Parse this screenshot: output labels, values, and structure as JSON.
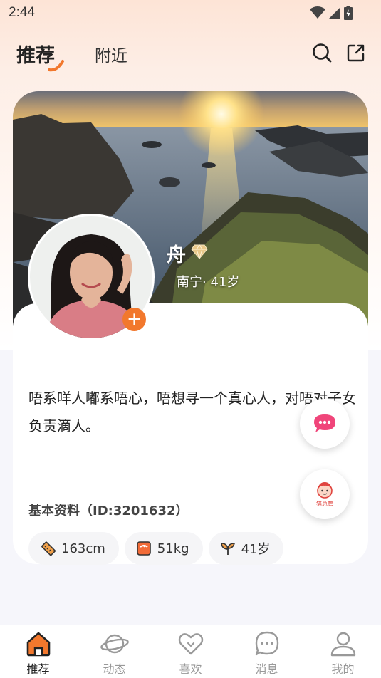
{
  "status": {
    "time": "2:44"
  },
  "header": {
    "tab_active": "推荐",
    "tab_other": "附近"
  },
  "profile": {
    "name": "舟",
    "location_age": "南宁· 41岁",
    "intro": "唔系咩人嘟系唔心，唔想寻一个真心人，对唔对子女负责滴人。",
    "basic_info_title": "基本资料（ID:3201632）",
    "chips": [
      {
        "icon": "ruler-icon",
        "label": "163cm"
      },
      {
        "icon": "scale-icon",
        "label": "51kg"
      },
      {
        "icon": "sprout-icon",
        "label": "41岁"
      }
    ]
  },
  "float_buttons": {
    "matchmaker_label": "猫总管"
  },
  "nav": {
    "items": [
      {
        "icon": "home-icon",
        "label": "推荐"
      },
      {
        "icon": "planet-icon",
        "label": "动态"
      },
      {
        "icon": "heart-icon",
        "label": "喜欢"
      },
      {
        "icon": "message-icon",
        "label": "消息"
      },
      {
        "icon": "user-icon",
        "label": "我的"
      }
    ]
  },
  "colors": {
    "accent": "#f2782d",
    "chat": "#f0457a"
  }
}
